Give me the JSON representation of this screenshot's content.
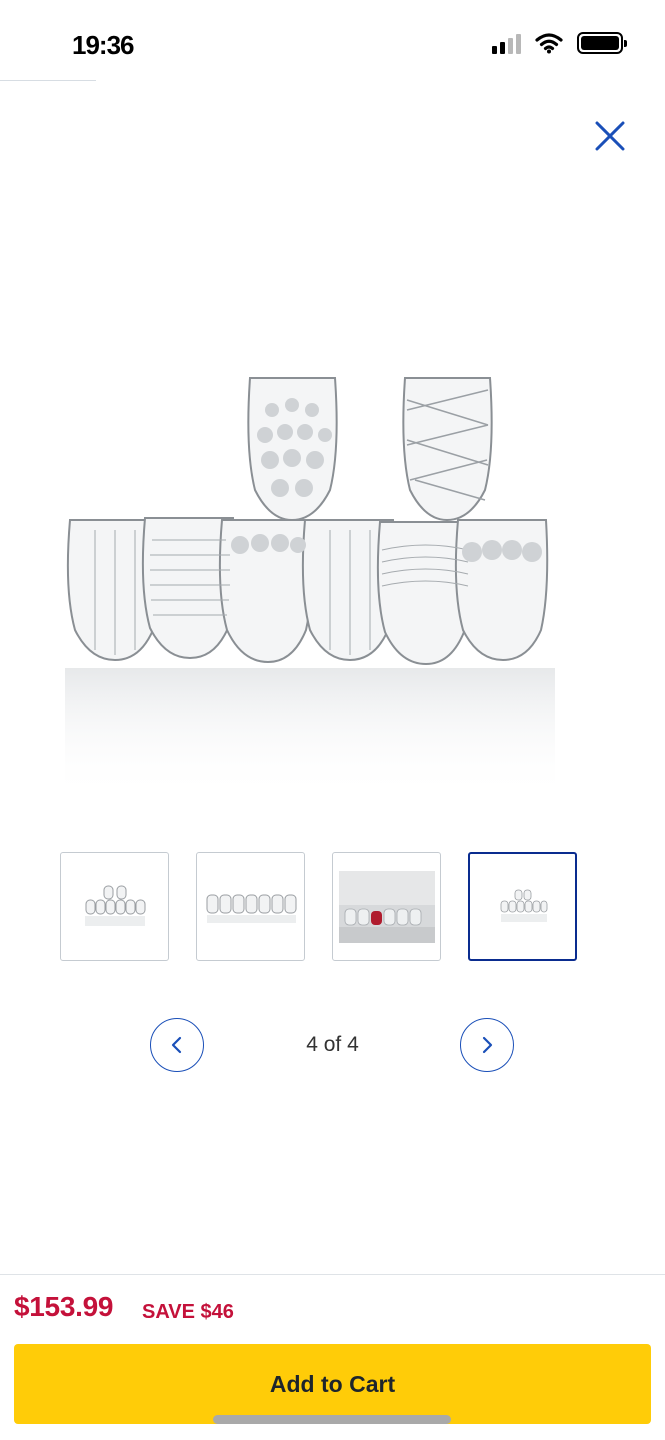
{
  "status_bar": {
    "time": "19:36",
    "icons": [
      "cellular-signal-icon",
      "wifi-icon",
      "battery-icon"
    ]
  },
  "header": {
    "close_icon": "close-icon"
  },
  "gallery": {
    "main_image": "glassware-set-image",
    "thumbnails": [
      {
        "name": "thumb-glasses-pyramid",
        "active": false
      },
      {
        "name": "thumb-glasses-row",
        "active": false
      },
      {
        "name": "thumb-glasses-lifestyle",
        "active": false
      },
      {
        "name": "thumb-glasses-pyramid-small",
        "active": true
      }
    ],
    "pager": {
      "text": "4 of 4",
      "current": 4,
      "total": 4
    }
  },
  "purchase": {
    "price": "$153.99",
    "save": "SAVE $46",
    "add_to_cart_label": "Add to Cart"
  },
  "colors": {
    "accent_blue": "#1a4fb8",
    "active_thumb_border": "#0a2c8f",
    "price_red": "#c4113a",
    "cart_yellow": "#ffcc08"
  }
}
